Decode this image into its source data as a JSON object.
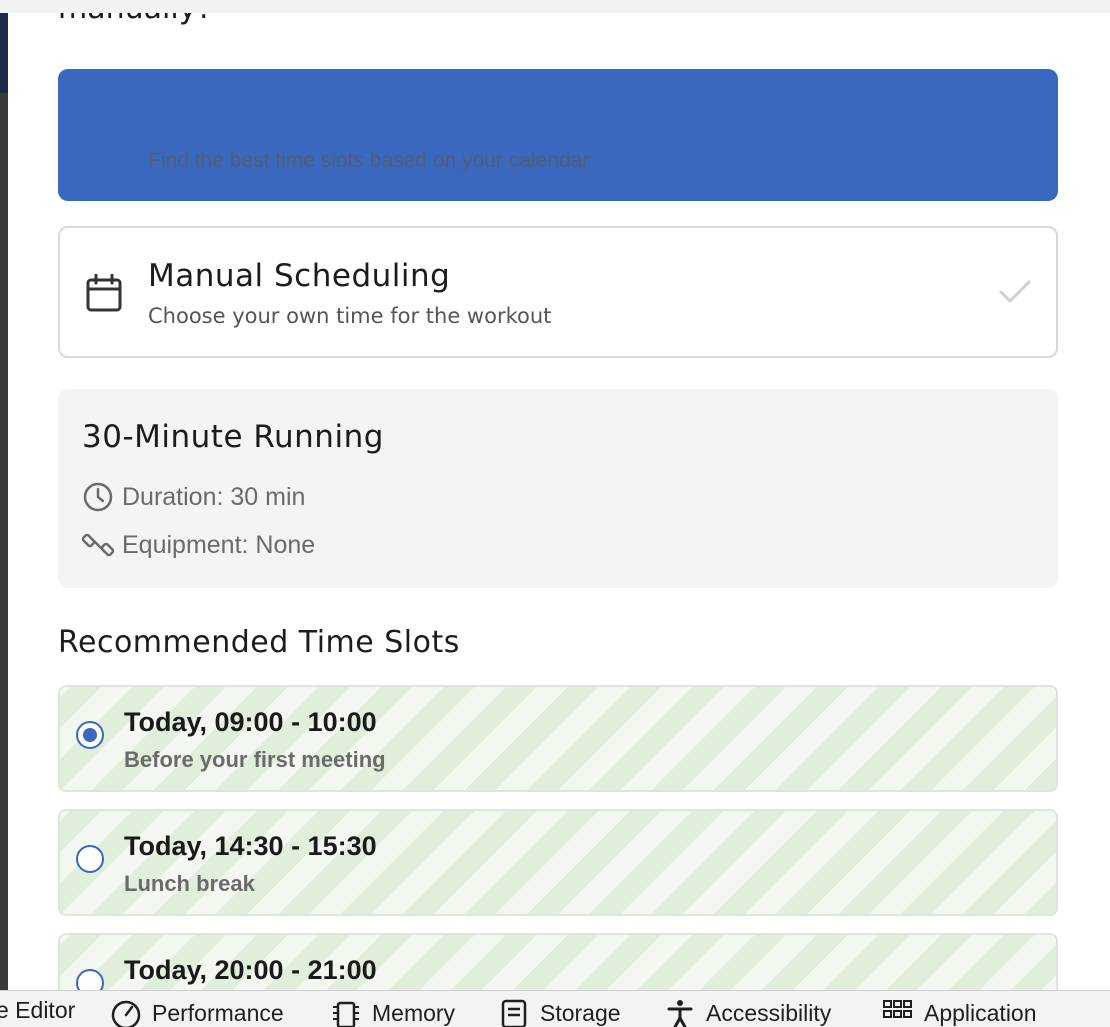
{
  "modal": {
    "title": "manually?",
    "auto_option": {
      "description": "Find the best time slots based on your calendar"
    },
    "manual_option": {
      "title": "Manual Scheduling",
      "description": "Choose your own time for the workout"
    }
  },
  "workout": {
    "title": "30-Minute Running",
    "duration": "Duration: 30 min",
    "equipment": "Equipment: None"
  },
  "slots_section": {
    "title": "Recommended Time Slots",
    "slots": [
      {
        "time": "Today, 09:00 - 10:00",
        "note": "Before your first meeting",
        "selected": true
      },
      {
        "time": "Today, 14:30 - 15:30",
        "note": "Lunch break",
        "selected": false
      },
      {
        "time": "Today, 20:00 - 21:00",
        "note": "",
        "selected": false
      }
    ]
  },
  "devtools": {
    "tabs": [
      "e Editor",
      "Performance",
      "Memory",
      "Storage",
      "Accessibility",
      "Application"
    ]
  },
  "colors": {
    "primary": "#3a68be",
    "slot_stripe_dark": "#e1eedb",
    "slot_stripe_light": "#f2f8ef",
    "card_bg": "#f4f4f3"
  },
  "icons": {
    "manual": "calendar-icon",
    "manual_selected": "check-icon",
    "duration": "clock-icon",
    "equipment": "dumbbell-icon"
  }
}
